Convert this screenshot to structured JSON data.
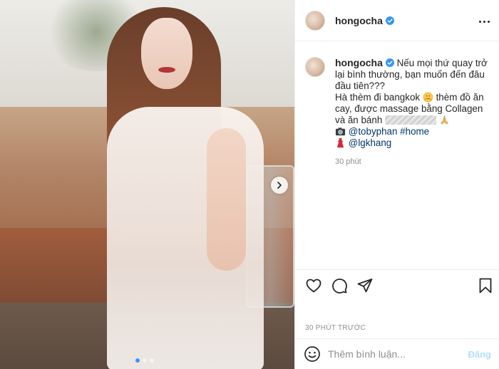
{
  "post": {
    "username": "hongocha",
    "verified": true,
    "carousel": {
      "slides": 3,
      "active_index": 0
    }
  },
  "caption": {
    "username": "hongocha",
    "line1": "Nếu mọi thứ quay trở lại bình thường, bạn muốn đến đâu đầu tiên???",
    "line2_a": "Hà thèm đi bangkok",
    "line2_b": "thèm đồ ăn cay, được massage bằng Collagen và ăn bánh",
    "line3_mention": "@tobyphan",
    "line3_hashtag": "#home",
    "line4_mention": "@lgkhang",
    "time": "30 phút"
  },
  "footer": {
    "timestamp": "30 PHÚT TRƯỚC",
    "comment_placeholder": "Thêm bình luận...",
    "post_label": "Đăng"
  },
  "icons": {
    "verified": "verified-badge-icon",
    "like": "heart-icon",
    "comment": "comment-icon",
    "share": "paper-plane-icon",
    "save": "bookmark-icon",
    "emoji": "smiley-icon",
    "more": "more-options-icon",
    "next": "chevron-right-icon"
  },
  "colors": {
    "link": "#00376b",
    "verified": "#3897f0",
    "muted": "#8e8e8e",
    "post_button_disabled": "#b2dffc"
  }
}
